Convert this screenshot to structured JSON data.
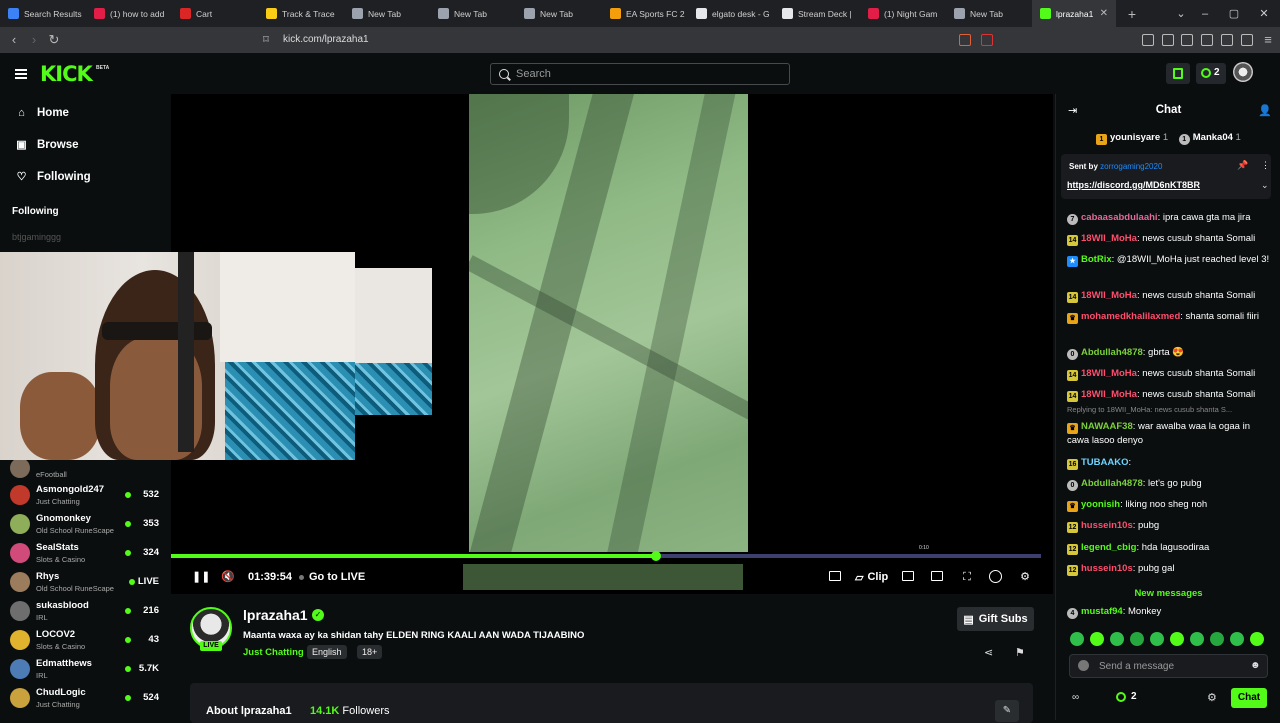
{
  "browser": {
    "tabs": [
      {
        "label": "Search Results",
        "color": "#3b82f6"
      },
      {
        "label": "(1) how to add",
        "color": "#e11d48"
      },
      {
        "label": "Cart",
        "color": "#dc2626"
      },
      {
        "label": "Track & Trace",
        "color": "#facc15"
      },
      {
        "label": "New Tab",
        "color": "#9ca3af"
      },
      {
        "label": "New Tab",
        "color": "#9ca3af"
      },
      {
        "label": "New Tab",
        "color": "#9ca3af"
      },
      {
        "label": "EA Sports FC 2",
        "color": "#f59e0b"
      },
      {
        "label": "elgato desk - G",
        "color": "#e5e7eb"
      },
      {
        "label": "Stream Deck |",
        "color": "#e5e7eb"
      },
      {
        "label": "(1) Night Gam",
        "color": "#e11d48"
      },
      {
        "label": "New Tab",
        "color": "#9ca3af"
      }
    ],
    "active_tab": {
      "label": "lprazaha1",
      "color": "#53fc18"
    },
    "url": "kick.com/lprazaha1"
  },
  "header": {
    "logo": "KICK",
    "beta": "BETA",
    "search_placeholder": "Search",
    "notif_count": "2"
  },
  "sidebar": {
    "nav": [
      {
        "label": "Home",
        "icon": "home-icon",
        "glyph": "⌂"
      },
      {
        "label": "Browse",
        "icon": "browse-icon",
        "glyph": "▣"
      },
      {
        "label": "Following",
        "icon": "heart-icon",
        "glyph": "♡"
      }
    ],
    "following_title": "Following",
    "ghost_item": "btjgaminggg",
    "channels": [
      {
        "name": "",
        "category": "eFootball",
        "viewers": "",
        "color": "#7c6a5a"
      },
      {
        "name": "Asmongold247",
        "category": "Just Chatting",
        "viewers": "532",
        "color": "#c0392b"
      },
      {
        "name": "Gnomonkey",
        "category": "Old School RuneScape",
        "viewers": "353",
        "color": "#8fae5a"
      },
      {
        "name": "SealStats",
        "category": "Slots & Casino",
        "viewers": "324",
        "color": "#d04a7a"
      },
      {
        "name": "Rhys",
        "category": "Old School RuneScape",
        "viewers": "LIVE",
        "color": "#9b7d5e"
      },
      {
        "name": "sukasblood",
        "category": "IRL",
        "viewers": "216",
        "color": "#6e6e6e"
      },
      {
        "name": "LOCOV2",
        "category": "Slots & Casino",
        "viewers": "43",
        "color": "#e0b32e"
      },
      {
        "name": "Edmatthews",
        "category": "IRL",
        "viewers": "5.7K",
        "color": "#4d7bb5"
      },
      {
        "name": "ChudLogic",
        "category": "Just Chatting",
        "viewers": "524",
        "color": "#c9a13d"
      }
    ]
  },
  "player": {
    "elapsed": "01:39:54",
    "go_live": "Go to LIVE",
    "clip_label": "Clip",
    "progress_fraction": 0.557,
    "marker_label": "0:10"
  },
  "stream": {
    "streamer": "lprazaha1",
    "live_label": "LIVE",
    "title": "Maanta waxa ay ka shidan tahy ELDEN RING KAALI AAN WADA TIJAABINO",
    "category": "Just Chatting",
    "tags": [
      "English",
      "18+"
    ],
    "gift_subs": "Gift Subs",
    "about_title": "About lprazaha1",
    "followers_count": "14.1K",
    "followers_label": "Followers"
  },
  "chat": {
    "title": "Chat",
    "gifters": [
      {
        "name": "younisyare",
        "count": "1"
      },
      {
        "name": "Manka04",
        "count": "1"
      }
    ],
    "pinned_sent_by": "Sent by",
    "pinned_user": "zorrogaming2020",
    "pinned_link": "https://discord.gg/MD6nKT8BR",
    "messages": [
      {
        "badge": "7",
        "badge_class": "round",
        "user": "cabaasabdulaahi",
        "color": "#e26a9a",
        "text": ": ipra cawa gta ma jira"
      },
      {
        "badge": "14",
        "badge_class": "",
        "user": "18WII_MoHa",
        "color": "#ff4d6d",
        "text": ": news cusub shanta Somali"
      },
      {
        "badge": "★",
        "badge_class": "blue",
        "user": "BotRix",
        "color": "#53fc18",
        "text": ": @18WII_MoHa just reached level 3!"
      },
      {
        "badge": "14",
        "badge_class": "",
        "user": "18WII_MoHa",
        "color": "#ff4d6d",
        "text": ": news cusub shanta Somali"
      },
      {
        "badge": "",
        "badge_class": "",
        "user": "mohamedkhalilaxmed",
        "color": "#ff4d6d",
        "text": ": shanta somali fiiri"
      },
      {
        "badge": "0",
        "badge_class": "round",
        "user": "Abdullah4878",
        "color": "#7bd13a",
        "text": ": gbrta 😍"
      },
      {
        "badge": "14",
        "badge_class": "",
        "user": "18WII_MoHa",
        "color": "#ff4d6d",
        "text": ": news cusub shanta Somali"
      },
      {
        "badge": "14",
        "badge_class": "",
        "user": "18WII_MoHa",
        "color": "#ff4d6d",
        "text": ": news cusub shanta Somali"
      },
      {
        "badge": "",
        "badge_class": "",
        "user": "NAWAAF38",
        "color": "#7bd13a",
        "text": ": war awalba waa la ogaa in cawa lasoo denyo",
        "reply": "Replying to 18WII_MoHa: news cusub shanta S..."
      },
      {
        "badge": "16",
        "badge_class": "",
        "user": "TUBAAKO",
        "color": "#6fd3ff",
        "text": ":"
      },
      {
        "badge": "0",
        "badge_class": "round",
        "user": "Abdullah4878",
        "color": "#7bd13a",
        "text": ": let's go pubg"
      },
      {
        "badge": "",
        "badge_class": "",
        "user": "yoonisih",
        "color": "#53fc18",
        "text": ": liking noo sheg noh"
      },
      {
        "badge": "12",
        "badge_class": "",
        "user": "hussein10s",
        "color": "#ff4d6d",
        "text": ": pubg"
      },
      {
        "badge": "12",
        "badge_class": "",
        "user": "legend_cbig",
        "color": "#53fc18",
        "text": ": hda lagusodiraa"
      },
      {
        "badge": "12",
        "badge_class": "",
        "user": "hussein10s",
        "color": "#ff4d6d",
        "text": ": pubg gal"
      }
    ],
    "new_messages": "New messages",
    "last_message": {
      "user": "mustaf94",
      "text": ": Monkey"
    },
    "input_placeholder": "Send a message",
    "bottom_count": "2",
    "send_label": "Chat"
  }
}
